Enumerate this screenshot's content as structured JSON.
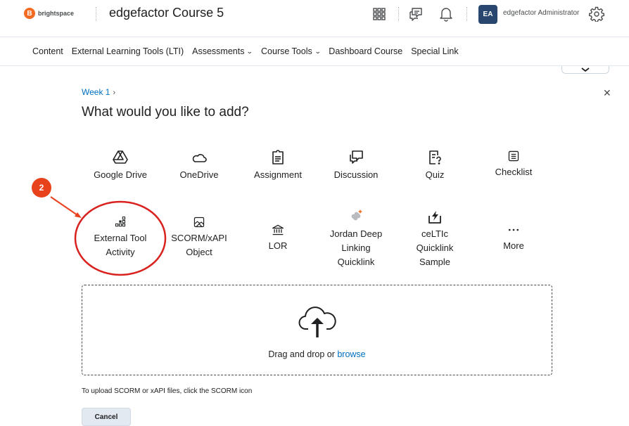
{
  "header": {
    "logo_text": "brightspace",
    "course_title": "edgefactor Course 5",
    "user_initials": "EA",
    "user_name": "edgefactor Administrator"
  },
  "nav": {
    "items": [
      {
        "label": "Content",
        "has_menu": false
      },
      {
        "label": "External Learning Tools (LTI)",
        "has_menu": false
      },
      {
        "label": "Assessments",
        "has_menu": true
      },
      {
        "label": "Course Tools",
        "has_menu": true
      },
      {
        "label": "Dashboard Course",
        "has_menu": false
      },
      {
        "label": "Special Link",
        "has_menu": false
      }
    ]
  },
  "dialog": {
    "breadcrumb": "Week 1",
    "heading": "What would you like to add?",
    "tiles_row1": [
      {
        "label": "Google Drive",
        "icon": "google-drive-icon"
      },
      {
        "label": "OneDrive",
        "icon": "onedrive-icon"
      },
      {
        "label": "Assignment",
        "icon": "assignment-icon"
      },
      {
        "label": "Discussion",
        "icon": "discussion-icon"
      },
      {
        "label": "Quiz",
        "icon": "quiz-icon"
      },
      {
        "label": "Checklist",
        "icon": "checklist-icon"
      }
    ],
    "tiles_row2": [
      {
        "label_line1": "External Tool",
        "label_line2": "Activity",
        "label_line3": "",
        "icon": "external-tool-icon"
      },
      {
        "label_line1": "SCORM/xAPI",
        "label_line2": "Object",
        "label_line3": "",
        "icon": "scorm-icon"
      },
      {
        "label_line1": "LOR",
        "label_line2": "",
        "label_line3": "",
        "icon": "lor-icon"
      },
      {
        "label_line1": "Jordan Deep",
        "label_line2": "Linking",
        "label_line3": "Quicklink",
        "icon": "deep-linking-icon"
      },
      {
        "label_line1": "ceLTIc",
        "label_line2": "Quicklink",
        "label_line3": "Sample",
        "icon": "quicklink-icon"
      },
      {
        "label_line1": "More",
        "label_line2": "",
        "label_line3": "",
        "icon": "more-icon"
      }
    ],
    "dropzone": {
      "text": "Drag and drop or ",
      "link": "browse"
    },
    "hint": "To upload SCORM or xAPI files, click the SCORM icon",
    "cancel_label": "Cancel"
  },
  "annotation": {
    "step_number": "2",
    "color": "#d9211e"
  },
  "colors": {
    "link": "#006fbf",
    "avatar_bg": "#29466e",
    "logo_orange": "#f26b21"
  }
}
